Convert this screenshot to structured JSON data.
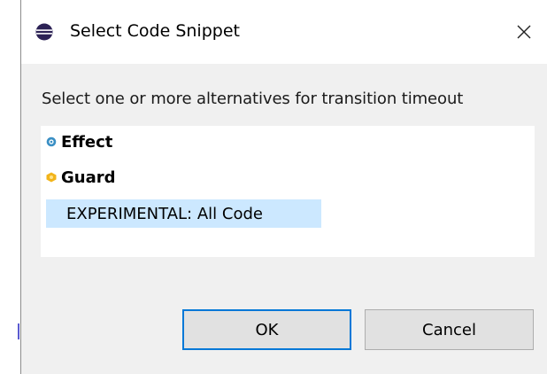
{
  "dialog": {
    "title": "Select Code Snippet",
    "close_glyph": "×",
    "prompt": "Select one or more alternatives for transition timeout",
    "items": [
      {
        "label": "Effect",
        "icon": "effect-icon",
        "bold": true,
        "selected": false
      },
      {
        "label": "Guard",
        "icon": "guard-icon",
        "bold": true,
        "selected": false
      },
      {
        "label": "EXPERIMENTAL: All Code",
        "icon": "",
        "bold": false,
        "selected": true
      }
    ],
    "ok_label": "OK",
    "cancel_label": "Cancel"
  },
  "colors": {
    "selection": "#cce8ff",
    "default_button_border": "#0078d7",
    "dialog_bg": "#f0f0f0"
  }
}
